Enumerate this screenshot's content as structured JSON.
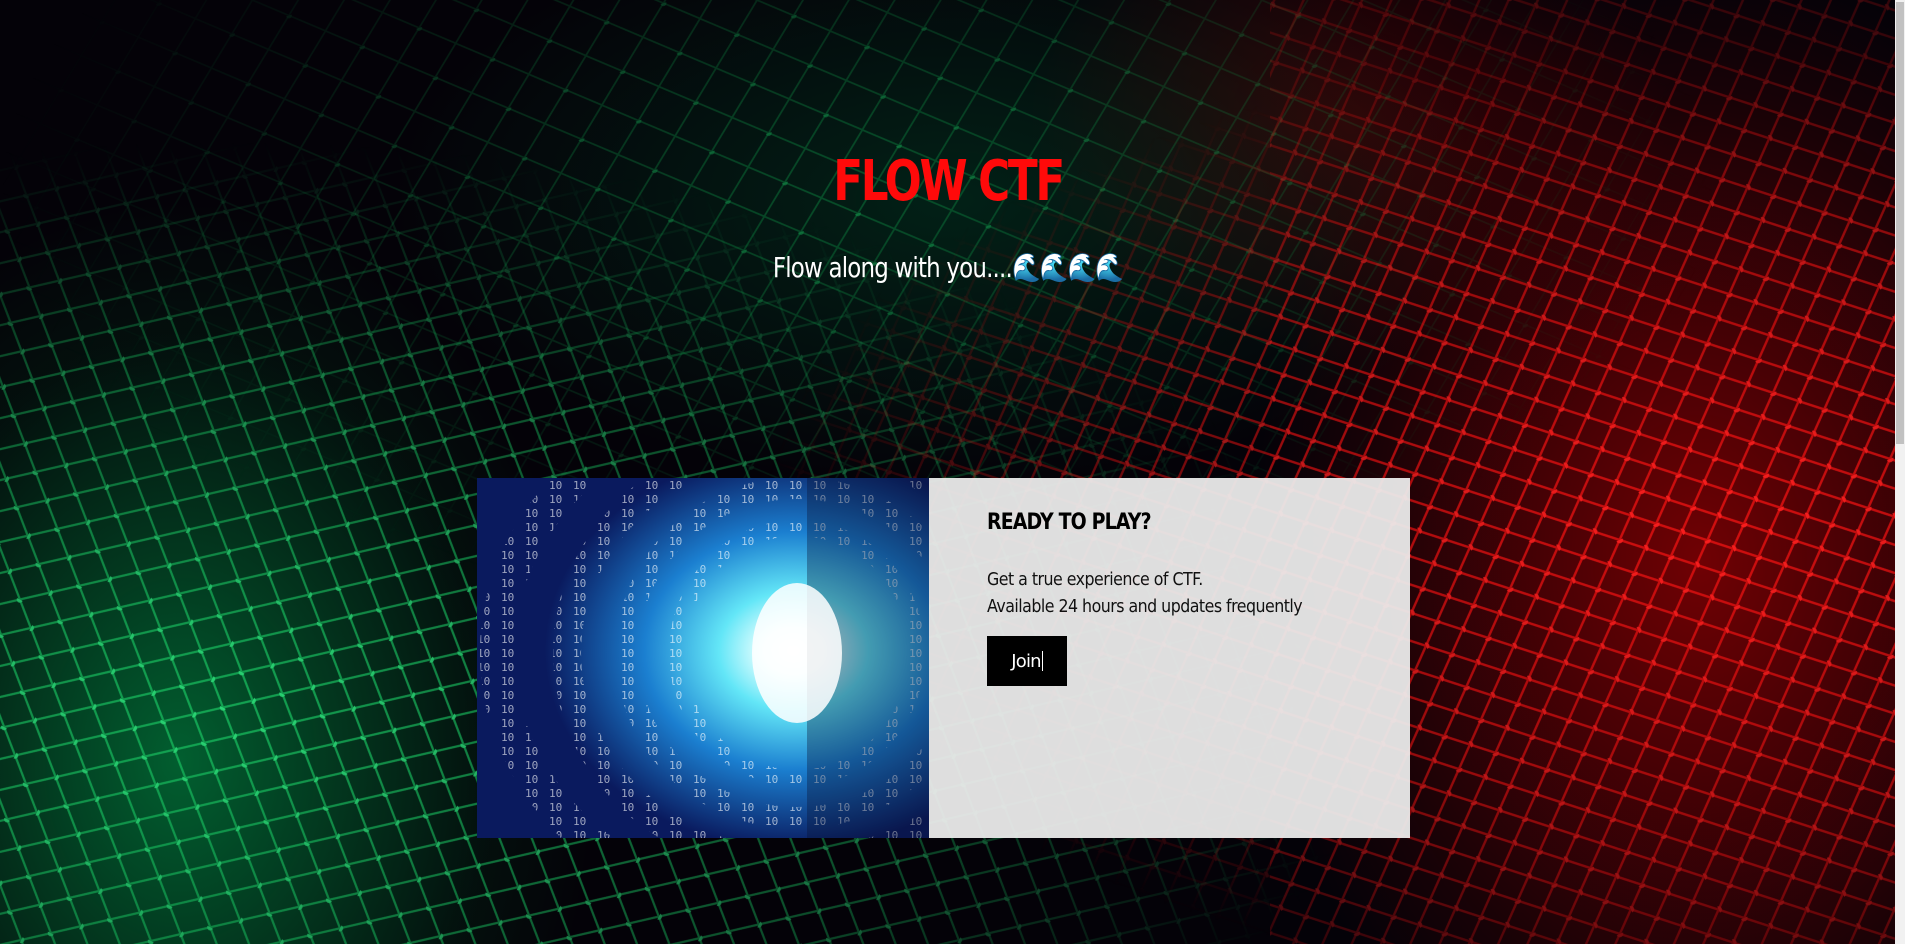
{
  "hero": {
    "title": "FLOW CTF",
    "tagline": "Flow along with you....🌊🌊🌊🌊"
  },
  "card": {
    "image_icon": "binary-tunnel-image",
    "heading": "READY TO PLAY?",
    "line1": "Get a true experience of CTF.",
    "line2": "Available 24 hours and updates frequently",
    "join_label": "Join"
  },
  "colors": {
    "title": "#ff0a0a",
    "panel": "#ececec",
    "button": "#000000"
  }
}
